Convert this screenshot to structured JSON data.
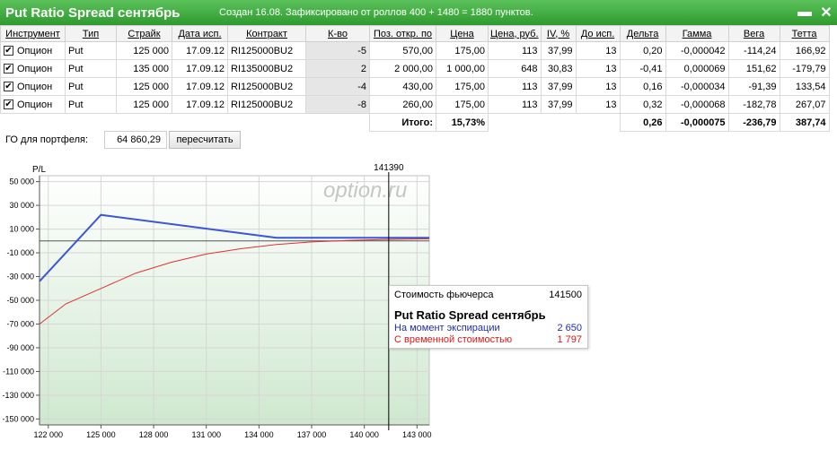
{
  "window": {
    "title": "Put Ratio Spread сентябрь",
    "subtitle": "Создан 16.08. Зафиксировано от роллов 400 + 1480 = 1880 пунктов.",
    "minimize_icon": "▬",
    "close_icon": "✕"
  },
  "table": {
    "headers": [
      "Инструмент",
      "Тип",
      "Страйк",
      "Дата исп.",
      "Контракт",
      "К-во",
      "Поз. откр. по",
      "Цена",
      "Цена, руб.",
      "IV, %",
      "До исп.",
      "Дельта",
      "Гамма",
      "Вега",
      "Тетта"
    ],
    "rows": [
      {
        "checked": true,
        "cells": [
          "Опцион",
          "Put",
          "125 000",
          "17.09.12",
          "RI125000BU2",
          "-5",
          "570,00",
          "175,00",
          "113",
          "37,99",
          "13",
          "0,20",
          "-0,000042",
          "-114,24",
          "166,92"
        ]
      },
      {
        "checked": true,
        "cells": [
          "Опцион",
          "Put",
          "135 000",
          "17.09.12",
          "RI135000BU2",
          "2",
          "2 000,00",
          "1 000,00",
          "648",
          "30,83",
          "13",
          "-0,41",
          "0,000069",
          "151,62",
          "-179,79"
        ]
      },
      {
        "checked": true,
        "cells": [
          "Опцион",
          "Put",
          "125 000",
          "17.09.12",
          "RI125000BU2",
          "-4",
          "430,00",
          "175,00",
          "113",
          "37,99",
          "13",
          "0,16",
          "-0,000034",
          "-91,39",
          "133,54"
        ]
      },
      {
        "checked": true,
        "cells": [
          "Опцион",
          "Put",
          "125 000",
          "17.09.12",
          "RI125000BU2",
          "-8",
          "260,00",
          "175,00",
          "113",
          "37,99",
          "13",
          "0,32",
          "-0,000068",
          "-182,78",
          "267,07"
        ]
      }
    ],
    "totals": {
      "label": "Итого:",
      "price_pct": "15,73%",
      "delta": "0,26",
      "gamma": "-0,000075",
      "vega": "-236,79",
      "theta": "387,74"
    }
  },
  "portfolio": {
    "go_label": "ГО для портфеля:",
    "go_value": "64 860,29",
    "recalc_label": "пересчитать"
  },
  "tooltip": {
    "header_label": "Стоимость фьючерса",
    "header_value": "141500",
    "title": "Put Ratio Spread сентябрь",
    "expiration_label": "На момент экспирации",
    "expiration_value": "2 650",
    "timevalue_label": "С временной стоимостью",
    "timevalue_value": "1 797"
  },
  "colors": {
    "expiration": "#3b57d6",
    "time_value": "#e03030",
    "chart_bg_top": "#ffffff",
    "chart_bg_bottom": "#cfe8cf"
  },
  "chart_data": {
    "type": "line",
    "ylabel": "P/L",
    "watermark": "option.ru",
    "cursor_label": "141390",
    "cursor_x": 141390,
    "xlim": [
      121500,
      143700
    ],
    "ylim": [
      -155000,
      55000
    ],
    "x_ticks": [
      122000,
      125000,
      128000,
      131000,
      134000,
      137000,
      140000,
      143000
    ],
    "x_tick_labels": [
      "122 000",
      "125 000",
      "128 000",
      "131 000",
      "134 000",
      "137 000",
      "140 000",
      "143 000"
    ],
    "y_ticks": [
      50000,
      30000,
      10000,
      -10000,
      -30000,
      -50000,
      -70000,
      -90000,
      -110000,
      -130000,
      -150000
    ],
    "y_tick_labels": [
      "50 000",
      "30 000",
      "10 000",
      "-10 000",
      "-30 000",
      "-50 000",
      "-70 000",
      "-90 000",
      "-110 000",
      "-130 000",
      "-150 000"
    ],
    "grid": true,
    "series": [
      {
        "name": "На момент экспирации",
        "x": [
          121500,
          125000,
          135000,
          143700
        ],
        "y": [
          -34000,
          22000,
          2650,
          2650
        ]
      },
      {
        "name": "С временной стоимостью",
        "x": [
          121500,
          123000,
          125000,
          127000,
          129000,
          131000,
          133000,
          135000,
          137000,
          139000,
          141000,
          143700
        ],
        "y": [
          -70000,
          -53000,
          -40000,
          -27000,
          -18000,
          -11000,
          -6500,
          -3000,
          -800,
          400,
          1200,
          1797
        ]
      }
    ]
  }
}
